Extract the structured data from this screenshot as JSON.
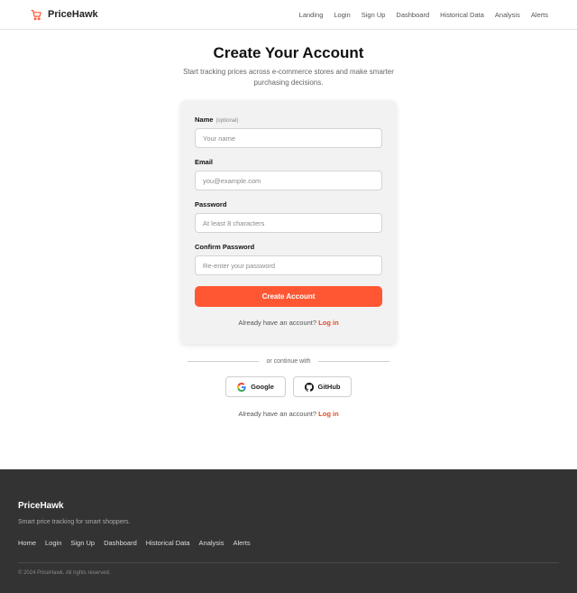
{
  "brand": {
    "name": "PriceHawk",
    "icon": "shopping-cart-icon",
    "accent": "#ff5733"
  },
  "nav": [
    "Landing",
    "Login",
    "Sign Up",
    "Dashboard",
    "Historical Data",
    "Analysis",
    "Alerts"
  ],
  "hero": {
    "title": "Create Your Account",
    "subtitle": "Start tracking prices across e-commerce stores and make smarter purchasing decisions."
  },
  "form": {
    "name": {
      "label": "Name",
      "optional": "(optional)",
      "placeholder": "Your name",
      "value": ""
    },
    "email": {
      "label": "Email",
      "placeholder": "you@example.com",
      "value": ""
    },
    "password": {
      "label": "Password",
      "placeholder": "At least 8 characters",
      "value": ""
    },
    "confirm": {
      "label": "Confirm Password",
      "placeholder": "Re-enter your password",
      "value": ""
    },
    "submit": "Create Account",
    "have_account": "Already have an account?",
    "login": "Log in"
  },
  "divider": "or continue with",
  "social": {
    "google": "Google",
    "github": "GitHub"
  },
  "alt_login": {
    "text": "Already have an account?",
    "link": "Log in"
  },
  "footer": {
    "brand": "PriceHawk",
    "tagline": "Smart price tracking for smart shoppers.",
    "links": [
      "Home",
      "Login",
      "Sign Up",
      "Dashboard",
      "Historical Data",
      "Analysis",
      "Alerts"
    ],
    "copyright": "© 2024 PriceHawk. All rights reserved."
  }
}
